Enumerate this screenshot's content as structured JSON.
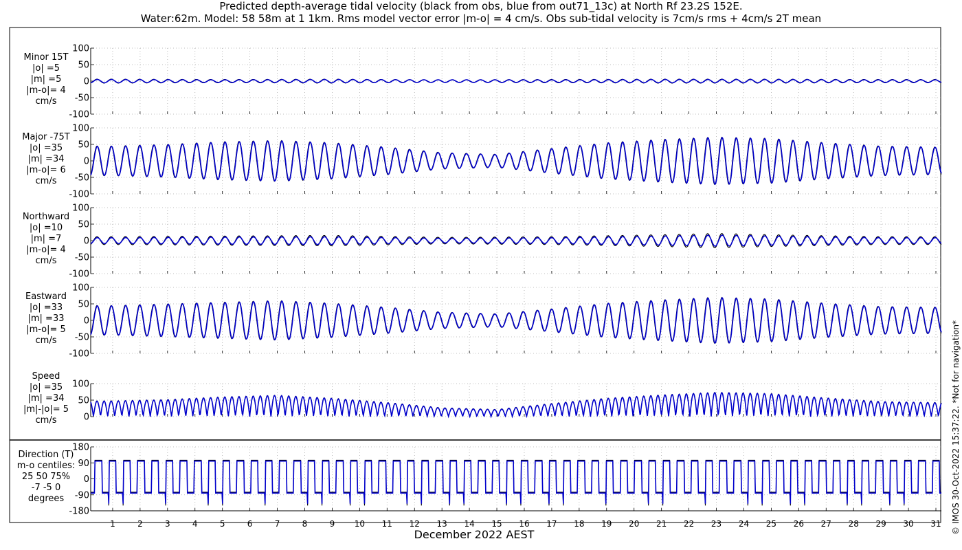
{
  "title_line1": "Predicted depth-average tidal velocity (black from obs, blue from out71_13c) at North Rf 23.2S 152E.",
  "title_line2": "Water:62m. Model: 58 58m at 1 1km. Rms model vector error |m-o| = 4 cm/s. Obs sub-tidal velocity is 7cm/s rms + 4cm/s 2T mean",
  "copyright": "© IMOS 30-Oct-2022 15:37:22. *Not for navigation*",
  "xlabel": "December 2022 AEST",
  "colors": {
    "obs": "#000000",
    "model": "#0000cc",
    "grid": "#aaaaaa"
  },
  "chart_data": [
    {
      "type": "line",
      "name": "Minor 15T",
      "label_lines": [
        "Minor 15T",
        "|o| =5",
        "|m| =5",
        "|m-o|= 4",
        "cm/s"
      ],
      "ylim": [
        -100,
        100
      ],
      "yticks": [
        -100,
        -50,
        0,
        50,
        100
      ],
      "yticklabels": [
        "-100",
        "-50",
        "0",
        "50",
        "100"
      ],
      "xlim": [
        0.2,
        31.2
      ],
      "xticks": [
        1,
        2,
        3,
        4,
        5,
        6,
        7,
        8,
        9,
        10,
        11,
        12,
        13,
        14,
        15,
        16,
        17,
        18,
        19,
        20,
        21,
        22,
        23,
        24,
        25,
        26,
        27,
        28,
        29,
        30,
        31
      ],
      "grid": true,
      "series": [
        {
          "name": "obs",
          "x": [
            1,
            5,
            9,
            13,
            17,
            21,
            25,
            29
          ],
          "y": [
            6,
            5,
            6,
            4,
            5,
            6,
            6,
            5
          ]
        },
        {
          "name": "model",
          "x": [
            1,
            5,
            9,
            13,
            17,
            21,
            25,
            29
          ],
          "y": [
            5,
            4,
            5,
            4,
            4,
            5,
            5,
            4
          ]
        }
      ]
    },
    {
      "type": "line",
      "name": "Major -75T",
      "label_lines": [
        "Major -75T",
        "|o| =35",
        "|m| =34",
        "|m-o|= 6",
        "cm/s"
      ],
      "ylim": [
        -100,
        100
      ],
      "yticks": [
        -100,
        -50,
        0,
        50,
        100
      ],
      "yticklabels": [
        "-100",
        "-50",
        "0",
        "50",
        "100"
      ],
      "xlim": [
        0.2,
        31.2
      ],
      "xticks": [
        1,
        2,
        3,
        4,
        5,
        6,
        7,
        8,
        9,
        10,
        11,
        12,
        13,
        14,
        15,
        16,
        17,
        18,
        19,
        20,
        21,
        22,
        23,
        24,
        25,
        26,
        27,
        28,
        29,
        30,
        31
      ],
      "grid": true,
      "series": [
        {
          "name": "obs",
          "x": [
            1,
            3,
            5,
            7,
            9,
            11,
            13,
            15,
            17,
            19,
            21,
            23,
            25,
            27,
            29,
            31
          ],
          "y": [
            45,
            50,
            58,
            62,
            55,
            42,
            25,
            20,
            38,
            55,
            65,
            72,
            68,
            55,
            45,
            42
          ]
        },
        {
          "name": "model",
          "x": [
            1,
            3,
            5,
            7,
            9,
            11,
            13,
            15,
            17,
            19,
            21,
            23,
            25,
            27,
            29,
            31
          ],
          "y": [
            44,
            49,
            57,
            61,
            54,
            41,
            24,
            19,
            37,
            54,
            64,
            71,
            67,
            54,
            44,
            41
          ]
        }
      ]
    },
    {
      "type": "line",
      "name": "Northward",
      "label_lines": [
        "Northward",
        "|o| =10",
        "|m| =7",
        "|m-o|= 4",
        "cm/s"
      ],
      "ylim": [
        -100,
        100
      ],
      "yticks": [
        -100,
        -50,
        0,
        50,
        100
      ],
      "yticklabels": [
        "-100",
        "-50",
        "0",
        "50",
        "100"
      ],
      "xlim": [
        0.2,
        31.2
      ],
      "xticks": [
        1,
        2,
        3,
        4,
        5,
        6,
        7,
        8,
        9,
        10,
        11,
        12,
        13,
        14,
        15,
        16,
        17,
        18,
        19,
        20,
        21,
        22,
        23,
        24,
        25,
        26,
        27,
        28,
        29,
        30,
        31
      ],
      "grid": true,
      "series": [
        {
          "name": "obs",
          "x": [
            1,
            5,
            9,
            13,
            17,
            21,
            23,
            25,
            29
          ],
          "y": [
            12,
            14,
            16,
            10,
            12,
            18,
            22,
            18,
            12
          ]
        },
        {
          "name": "model",
          "x": [
            1,
            5,
            9,
            13,
            17,
            21,
            23,
            25,
            29
          ],
          "y": [
            9,
            11,
            12,
            7,
            9,
            14,
            17,
            14,
            9
          ]
        }
      ]
    },
    {
      "type": "line",
      "name": "Eastward",
      "label_lines": [
        "Eastward",
        "|o| =33",
        "|m| =33",
        "|m-o|= 5",
        "cm/s"
      ],
      "ylim": [
        -100,
        100
      ],
      "yticks": [
        -100,
        -50,
        0,
        50,
        100
      ],
      "yticklabels": [
        "-100",
        "-50",
        "0",
        "50",
        "100"
      ],
      "xlim": [
        0.2,
        31.2
      ],
      "xticks": [
        1,
        2,
        3,
        4,
        5,
        6,
        7,
        8,
        9,
        10,
        11,
        12,
        13,
        14,
        15,
        16,
        17,
        18,
        19,
        20,
        21,
        22,
        23,
        24,
        25,
        26,
        27,
        28,
        29,
        30,
        31
      ],
      "grid": true,
      "series": [
        {
          "name": "obs",
          "x": [
            1,
            3,
            5,
            7,
            9,
            11,
            13,
            15,
            17,
            19,
            21,
            23,
            25,
            27,
            29,
            31
          ],
          "y": [
            45,
            50,
            55,
            60,
            52,
            40,
            25,
            20,
            35,
            52,
            62,
            70,
            65,
            52,
            42,
            40
          ]
        },
        {
          "name": "model",
          "x": [
            1,
            3,
            5,
            7,
            9,
            11,
            13,
            15,
            17,
            19,
            21,
            23,
            25,
            27,
            29,
            31
          ],
          "y": [
            44,
            49,
            54,
            59,
            51,
            39,
            24,
            19,
            34,
            51,
            61,
            69,
            64,
            51,
            41,
            39
          ]
        }
      ]
    },
    {
      "type": "line",
      "name": "Speed",
      "label_lines": [
        "Speed",
        "|o| =35",
        "|m| =34",
        "|m|-|o|= 5",
        "cm/s"
      ],
      "ylim": [
        0,
        100
      ],
      "yticks": [
        0,
        50,
        100
      ],
      "yticklabels": [
        "0",
        "50",
        "100"
      ],
      "xlim": [
        0.2,
        31.2
      ],
      "xticks": [
        1,
        2,
        3,
        4,
        5,
        6,
        7,
        8,
        9,
        10,
        11,
        12,
        13,
        14,
        15,
        16,
        17,
        18,
        19,
        20,
        21,
        22,
        23,
        24,
        25,
        26,
        27,
        28,
        29,
        30,
        31
      ],
      "grid": true,
      "series": [
        {
          "name": "obs",
          "x": [
            1,
            3,
            5,
            7,
            9,
            11,
            13,
            15,
            17,
            19,
            21,
            23,
            25,
            27,
            29,
            31
          ],
          "y": [
            48,
            52,
            60,
            65,
            56,
            43,
            27,
            22,
            40,
            56,
            66,
            74,
            70,
            57,
            46,
            43
          ]
        },
        {
          "name": "model",
          "x": [
            1,
            3,
            5,
            7,
            9,
            11,
            13,
            15,
            17,
            19,
            21,
            23,
            25,
            27,
            29,
            31
          ],
          "y": [
            47,
            51,
            59,
            64,
            55,
            42,
            26,
            21,
            39,
            55,
            65,
            73,
            69,
            56,
            45,
            42
          ]
        }
      ]
    },
    {
      "type": "line",
      "name": "Direction (T)",
      "label_lines": [
        "Direction (T)",
        "m-o centiles:",
        "25  50  75%",
        "-7 -5  0",
        "degrees"
      ],
      "ylim": [
        -180,
        180
      ],
      "yticks": [
        -180,
        -90,
        0,
        90,
        180
      ],
      "yticklabels": [
        "-180",
        "-90",
        "0",
        "90",
        "180"
      ],
      "xlim": [
        0.2,
        31.2
      ],
      "xticks": [
        1,
        2,
        3,
        4,
        5,
        6,
        7,
        8,
        9,
        10,
        11,
        12,
        13,
        14,
        15,
        16,
        17,
        18,
        19,
        20,
        21,
        22,
        23,
        24,
        25,
        26,
        27,
        28,
        29,
        30,
        31
      ],
      "xticklabels": [
        "1",
        "2",
        "3",
        "4",
        "5",
        "6",
        "7",
        "8",
        "9",
        "10",
        "11",
        "12",
        "13",
        "14",
        "15",
        "16",
        "17",
        "18",
        "19",
        "20",
        "21",
        "22",
        "23",
        "24",
        "25",
        "26",
        "27",
        "28",
        "29",
        "30",
        "31"
      ],
      "grid": true,
      "series": [
        {
          "name": "obs",
          "levels": [
            105,
            -75
          ]
        },
        {
          "name": "model",
          "levels": [
            100,
            -80
          ]
        }
      ]
    }
  ]
}
